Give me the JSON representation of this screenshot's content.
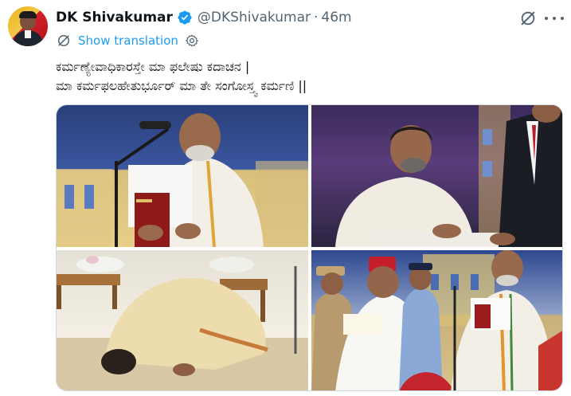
{
  "author": {
    "display_name": "DK Shivakumar",
    "handle": "@DKShivakumar",
    "separator": "·",
    "time": "46m",
    "verified": true
  },
  "translate": {
    "label": "Show translation"
  },
  "tweet": {
    "lines": [
      "ಕರ್ಮಣ್ಯೇವಾಧಿಕಾರಸ್ತೇ ಮಾ ಫಲೇಷು ಕದಾಚನ |",
      "ಮಾ ಕರ್ಮಫಲಹೇತುರ್ಭೂರ್ ಮಾ ತೇ ಸಂಗೋಸ್ತ್ವ ಕರ್ಮಣಿ ||"
    ]
  },
  "colors": {
    "accent": "#1d9bf0",
    "verified": "#1d9bf0",
    "muted": "#536471",
    "text": "#0f1419"
  },
  "icons": {
    "verified": "verified-badge-icon",
    "grok": "grok-icon",
    "more": "more-horizontal-icon",
    "translate": "translate-icon",
    "settings": "settings-gear-icon"
  },
  "media": {
    "count": 4
  }
}
